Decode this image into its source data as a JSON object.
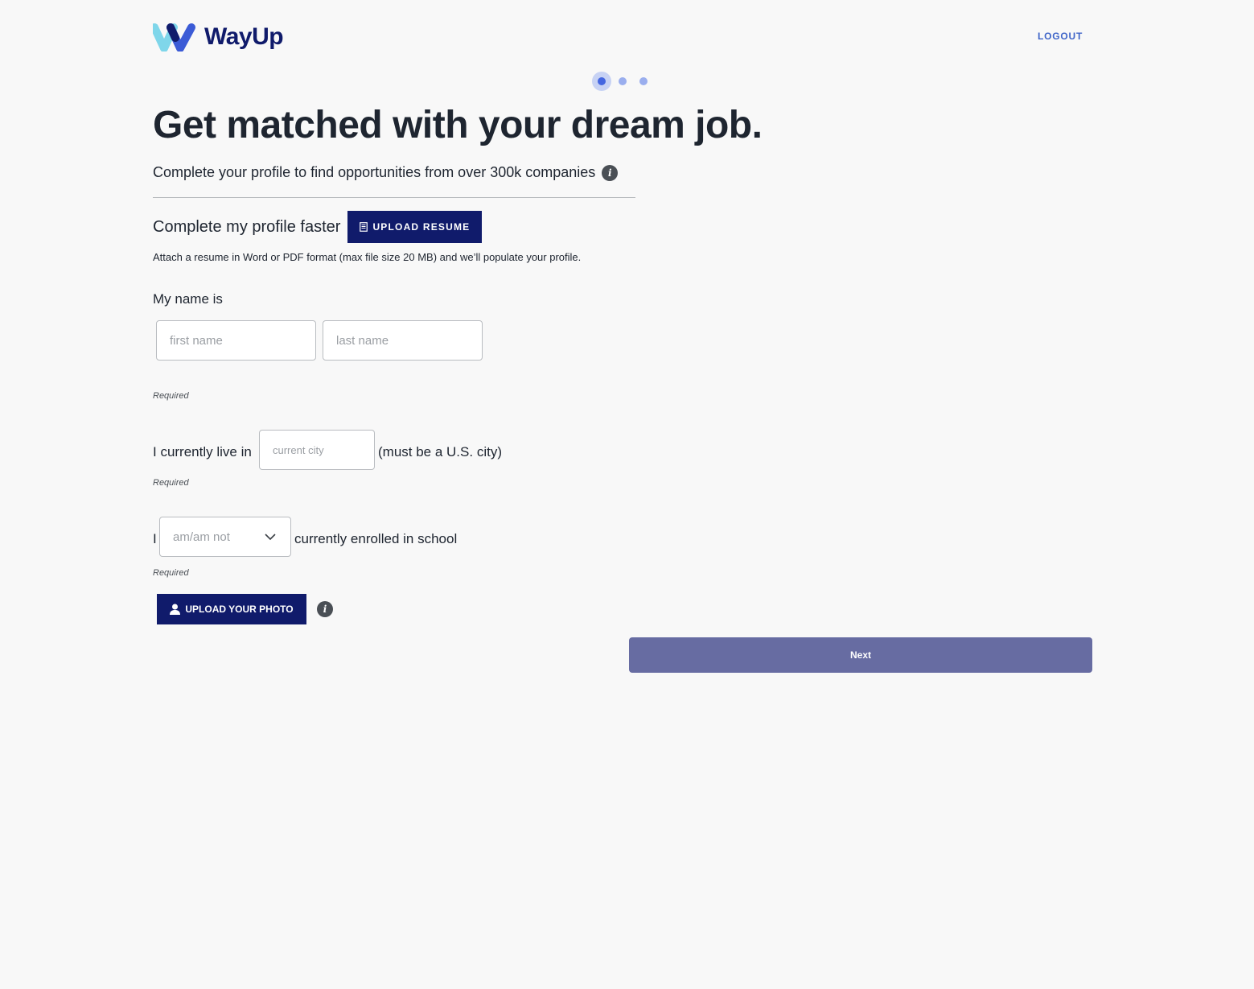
{
  "header": {
    "logo_text": "WayUp",
    "logout_label": "LOGOUT"
  },
  "progress": {
    "steps": 3,
    "current_step": 1
  },
  "main": {
    "title": "Get matched with your dream job.",
    "subtitle": "Complete your profile to find opportunities from over 300k companies",
    "resume": {
      "label": "Complete my profile faster",
      "button_label": "UPLOAD RESUME",
      "hint": "Attach a resume in Word or PDF format (max file size 20 MB) and we’ll populate your profile."
    },
    "name": {
      "label": "My name is",
      "first_placeholder": "first name",
      "last_placeholder": "last name",
      "required": "Required"
    },
    "city": {
      "prefix": "I currently live in",
      "placeholder": "current city",
      "suffix": "(must be a U.S. city)",
      "required": "Required"
    },
    "enrollment": {
      "prefix": "I",
      "selected_value": "am/am not",
      "suffix": "currently enrolled in school",
      "required": "Required"
    },
    "photo": {
      "button_label": "UPLOAD YOUR PHOTO"
    },
    "next_label": "Next"
  },
  "colors": {
    "brand_navy": "#101b6b",
    "accent_blue": "#3e64c8",
    "next_button": "#676ca2",
    "background": "#f8f8f8"
  },
  "icons": [
    "wayup-logo-icon",
    "info-icon",
    "document-icon",
    "chevron-down-icon",
    "user-icon"
  ]
}
